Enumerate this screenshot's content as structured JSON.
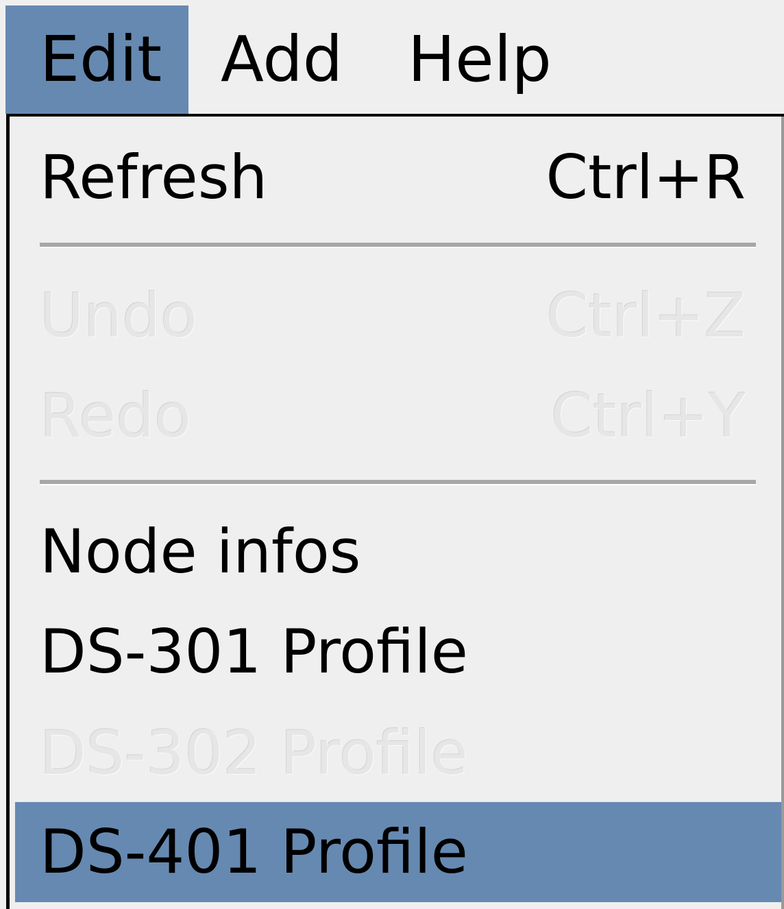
{
  "menubar": {
    "items": [
      {
        "label": "Edit",
        "active": true
      },
      {
        "label": "Add",
        "active": false
      },
      {
        "label": "Help",
        "active": false
      }
    ]
  },
  "dropdown": {
    "refresh": {
      "label": "Refresh",
      "shortcut": "Ctrl+R",
      "enabled": true
    },
    "undo": {
      "label": "Undo",
      "shortcut": "Ctrl+Z",
      "enabled": false
    },
    "redo": {
      "label": "Redo",
      "shortcut": "Ctrl+Y",
      "enabled": false
    },
    "node_infos": {
      "label": "Node infos",
      "enabled": true
    },
    "ds301": {
      "label": "DS-301 Profile",
      "enabled": true
    },
    "ds302": {
      "label": "DS-302 Profile",
      "enabled": false
    },
    "ds401": {
      "label": "DS-401 Profile",
      "enabled": true,
      "highlighted": true
    }
  },
  "colors": {
    "highlight": "#6689b1",
    "background": "#efefef",
    "disabled_text": "#e6e6e6"
  }
}
